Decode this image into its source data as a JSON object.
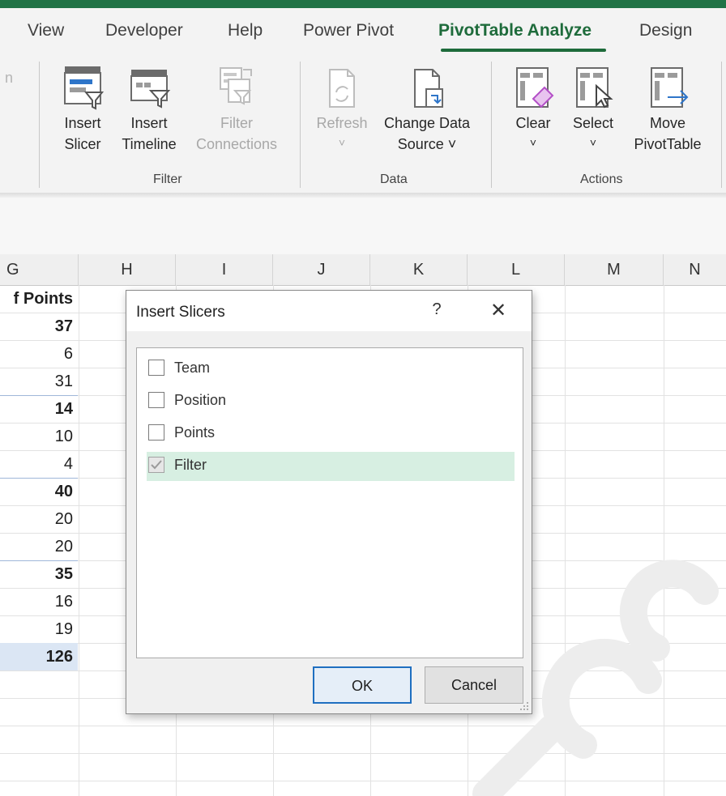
{
  "ribbon": {
    "tabs": [
      "View",
      "Developer",
      "Help",
      "Power Pivot",
      "PivotTable Analyze",
      "Design"
    ],
    "active_tab": "PivotTable Analyze",
    "left_fragment": "n",
    "groups": {
      "filter": {
        "label": "Filter",
        "insert_slicer": [
          "Insert",
          "Slicer"
        ],
        "insert_timeline": [
          "Insert",
          "Timeline"
        ],
        "filter_connections": [
          "Filter",
          "Connections"
        ]
      },
      "data": {
        "label": "Data",
        "refresh": [
          "Refresh",
          "˅"
        ],
        "change_data_source": [
          "Change Data",
          "Source ˅"
        ]
      },
      "actions": {
        "label": "Actions",
        "clear": [
          "Clear",
          "˅"
        ],
        "select": [
          "Select",
          "˅"
        ],
        "move_pivottable": [
          "Move",
          "PivotTable"
        ]
      }
    },
    "accent_color": "#217346"
  },
  "sheet": {
    "columns": [
      "G",
      "H",
      "I",
      "J",
      "K",
      "L",
      "M",
      "N"
    ],
    "g_header": "f Points",
    "g_values": [
      {
        "v": "37",
        "bold": true
      },
      {
        "v": "6",
        "bold": false
      },
      {
        "v": "31",
        "bold": false
      },
      {
        "v": "14",
        "bold": true
      },
      {
        "v": "10",
        "bold": false
      },
      {
        "v": "4",
        "bold": false
      },
      {
        "v": "40",
        "bold": true
      },
      {
        "v": "20",
        "bold": false
      },
      {
        "v": "20",
        "bold": false
      },
      {
        "v": "35",
        "bold": true
      },
      {
        "v": "16",
        "bold": false
      },
      {
        "v": "19",
        "bold": false
      },
      {
        "v": "126",
        "bold": true,
        "total": true
      }
    ]
  },
  "dialog": {
    "title": "Insert Slicers",
    "help": "?",
    "close": "✕",
    "fields": [
      {
        "label": "Team",
        "checked": false
      },
      {
        "label": "Position",
        "checked": false
      },
      {
        "label": "Points",
        "checked": false
      },
      {
        "label": "Filter",
        "checked": true
      }
    ],
    "ok_label": "OK",
    "cancel_label": "Cancel"
  }
}
